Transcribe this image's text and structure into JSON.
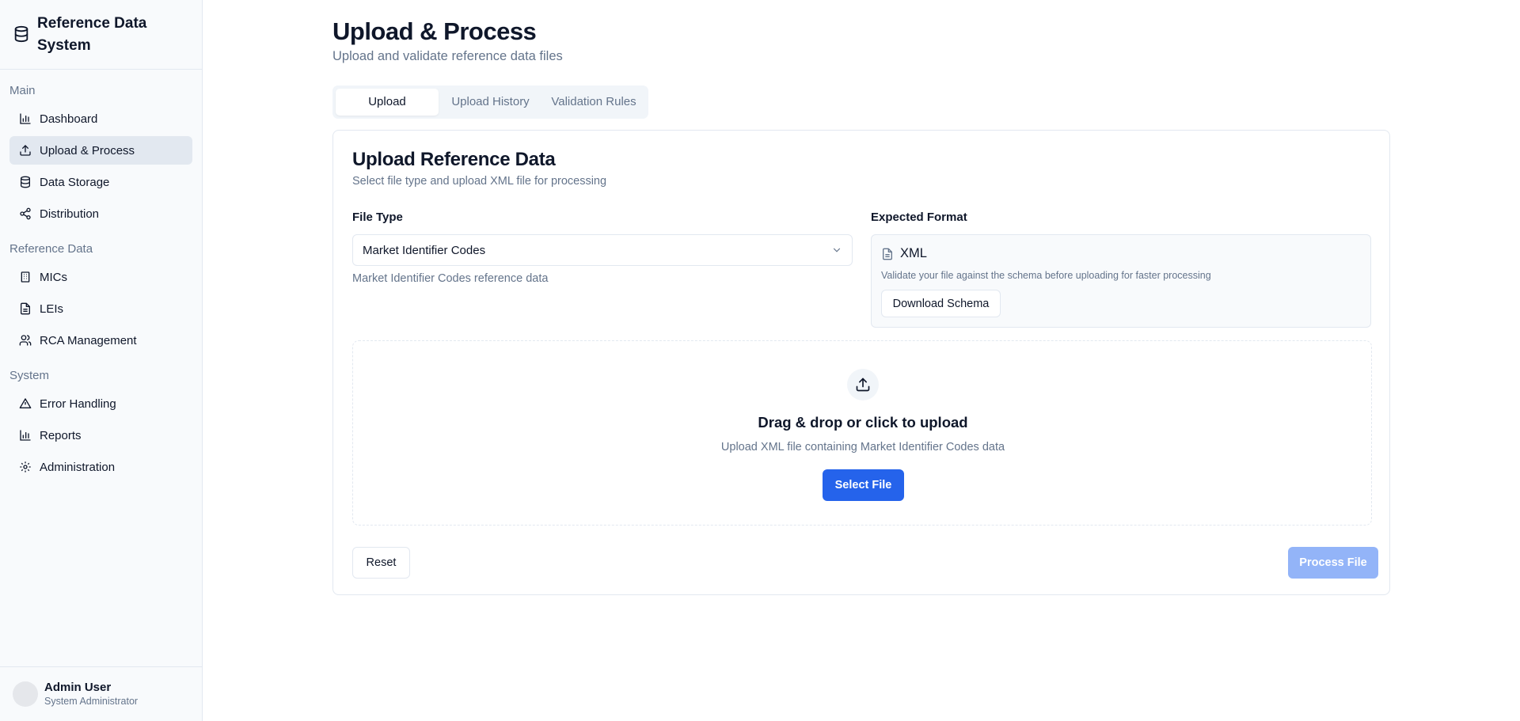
{
  "app": {
    "title": "Reference Data System"
  },
  "sidebar": {
    "groups": [
      {
        "label": "Main",
        "items": [
          "Dashboard",
          "Upload & Process",
          "Data Storage",
          "Distribution"
        ]
      },
      {
        "label": "Reference Data",
        "items": [
          "MICs",
          "LEIs",
          "RCA Management"
        ]
      },
      {
        "label": "System",
        "items": [
          "Error Handling",
          "Reports",
          "Administration"
        ]
      }
    ],
    "active_item": "Upload & Process",
    "user": {
      "name": "Admin User",
      "role": "System Administrator"
    }
  },
  "page": {
    "title": "Upload & Process",
    "subtitle": "Upload and validate reference data files"
  },
  "tabs": {
    "items": [
      "Upload",
      "Upload History",
      "Validation Rules"
    ],
    "active": "Upload"
  },
  "card": {
    "title": "Upload Reference Data",
    "subtitle": "Select file type and upload XML file for processing",
    "file_type": {
      "label": "File Type",
      "value": "Market Identifier Codes",
      "help": "Market Identifier Codes reference data"
    },
    "expected_format": {
      "label": "Expected Format",
      "format": "XML",
      "note": "Validate your file against the schema before uploading for faster processing",
      "download_label": "Download Schema"
    },
    "dropzone": {
      "title": "Drag & drop or click to upload",
      "subtitle": "Upload XML file containing Market Identifier Codes data",
      "button": "Select File"
    },
    "reset_label": "Reset",
    "process_label": "Process File",
    "process_disabled": true
  },
  "colors": {
    "primary": "#2563eb",
    "primary_disabled": "#93b4f8",
    "sidebar_bg": "#f8fafc",
    "active_nav_bg": "#e2e8f0",
    "muted_text": "#64748b",
    "border": "#e2e8f0"
  },
  "icons": {
    "brand": "database-icon",
    "Dashboard": "bar-chart-icon",
    "Upload & Process": "upload-icon",
    "Data Storage": "database-icon",
    "Distribution": "share-icon",
    "MICs": "building-icon",
    "LEIs": "file-text-icon",
    "RCA Management": "users-icon",
    "Error Handling": "alert-triangle-icon",
    "Reports": "bar-chart-icon",
    "Administration": "gear-icon"
  }
}
